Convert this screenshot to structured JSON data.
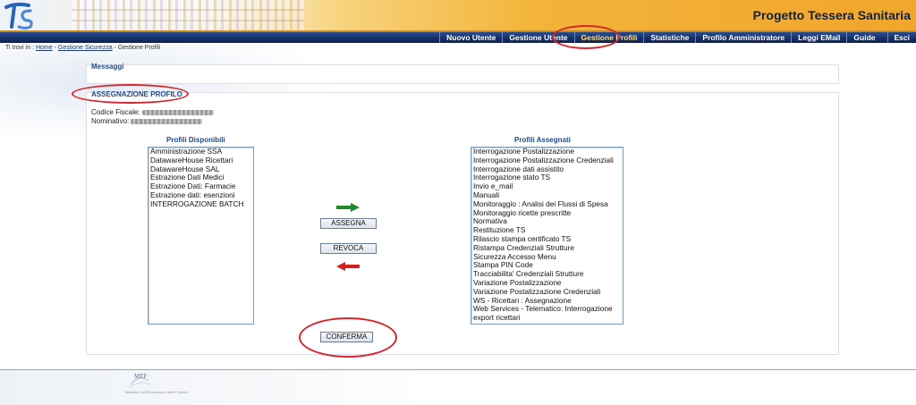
{
  "header": {
    "app_title": "Progetto Tessera Sanitaria",
    "logo_text": "TS"
  },
  "nav": {
    "items": [
      {
        "label": "Nuovo Utente"
      },
      {
        "label": "Gestione Utente"
      },
      {
        "label": "Gestione Profili",
        "active": true
      },
      {
        "label": "Statistiche"
      },
      {
        "label": "Profilo Amministratore"
      },
      {
        "label": "Leggi EMail"
      },
      {
        "label": "Guide"
      },
      {
        "label": "Esci"
      }
    ]
  },
  "breadcrumb": {
    "prefix": "Ti trovi in : ",
    "home": "Home",
    "sep1": " - ",
    "section": "Gestione Sicurezza",
    "sep2": " - ",
    "current": "Gestione Profili"
  },
  "messages": {
    "title": "Messaggi"
  },
  "assign": {
    "title": "ASSEGNAZIONE PROFILO",
    "codice_label": "Codice Fiscale:",
    "nominativo_label": "Nominativo:",
    "available_label": "Profili Disponibili",
    "assigned_label": "Profili Assegnati",
    "available": [
      "Amministrazione SSA",
      "DatawareHouse Ricettari",
      "DatawareHouse SAL",
      "Estrazione Dati Medici",
      "Estrazione Dati: Farmacie",
      "Estrazione dati: esenzioni",
      "INTERROGAZIONE BATCH"
    ],
    "assigned": [
      "Interrogazione Postalizzazione",
      "Interrogazione Postalizzazione Credenziali",
      "Interrogazione dati assistito",
      "Interrogazione stato TS",
      "Invio e_mail",
      "Manuali",
      "Monitoraggio : Analisi dei Flussi di Spesa",
      "Monitoraggio ricette prescritte",
      "Normativa",
      "Restituzione TS",
      "Rilascio stampa certificato TS",
      "Ristampa Credenziali Strutture",
      "Sicurezza Accesso Menu",
      "Stampa PIN Code",
      "Tracciabilita' Credenziali Strutture",
      "Variazione Postalizzazione",
      "Variazione Postalizzazione Credenziali",
      "WS - Ricettari : Assegnazione",
      "Web Services - Telematico: Interrogazione",
      "export ricettari"
    ],
    "assegna_label": "ASSEGNA",
    "revoca_label": "REVOCA",
    "conferma_label": "CONFERMA"
  },
  "footer": {
    "logo_text": "MEF",
    "subtitle": "Ministero dell'Economia e delle Finanze"
  },
  "colors": {
    "highlight": "#d7262e",
    "nav_bg": "#15306a",
    "header_accent": "#f3b43a",
    "assign_arrow": "#1f8a2a",
    "revoke_arrow": "#d21f1f"
  },
  "icons": {
    "assign_arrow": "arrow-right-icon",
    "revoke_arrow": "arrow-left-icon"
  }
}
